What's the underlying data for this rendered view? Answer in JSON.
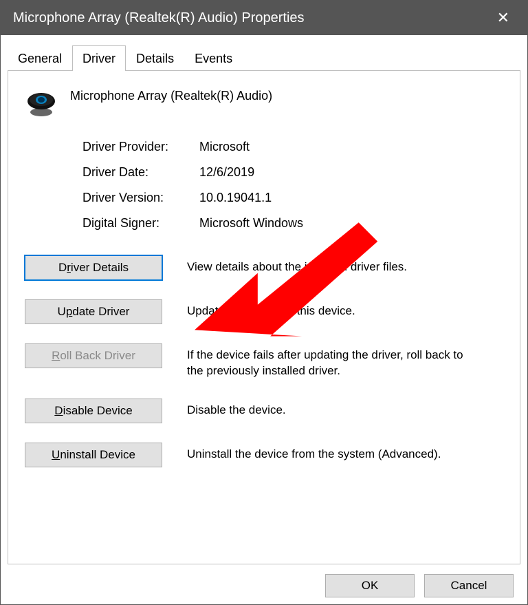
{
  "window": {
    "title": "Microphone Array (Realtek(R) Audio) Properties"
  },
  "tabs": [
    {
      "label": "General",
      "active": false
    },
    {
      "label": "Driver",
      "active": true
    },
    {
      "label": "Details",
      "active": false
    },
    {
      "label": "Events",
      "active": false
    }
  ],
  "device": {
    "name": "Microphone Array (Realtek(R) Audio)"
  },
  "info": {
    "provider_label": "Driver Provider:",
    "provider_value": "Microsoft",
    "date_label": "Driver Date:",
    "date_value": "12/6/2019",
    "version_label": "Driver Version:",
    "version_value": "10.0.19041.1",
    "signer_label": "Digital Signer:",
    "signer_value": "Microsoft Windows"
  },
  "actions": {
    "details": {
      "label_pre": "D",
      "label_accel": "r",
      "label_post": "iver Details",
      "desc": "View details about the installed driver files."
    },
    "update": {
      "label_pre": "U",
      "label_accel": "p",
      "label_post": "date Driver",
      "desc": "Update the driver for this device."
    },
    "rollback": {
      "label_pre": "",
      "label_accel": "R",
      "label_post": "oll Back Driver",
      "desc": "If the device fails after updating the driver, roll back to the previously installed driver."
    },
    "disable": {
      "label_pre": "",
      "label_accel": "D",
      "label_post": "isable Device",
      "desc": "Disable the device."
    },
    "uninstall": {
      "label_pre": "",
      "label_accel": "U",
      "label_post": "ninstall Device",
      "desc": "Uninstall the device from the system (Advanced)."
    }
  },
  "footer": {
    "ok": "OK",
    "cancel": "Cancel"
  },
  "annotation": {
    "arrow_color": "#ff0000"
  }
}
